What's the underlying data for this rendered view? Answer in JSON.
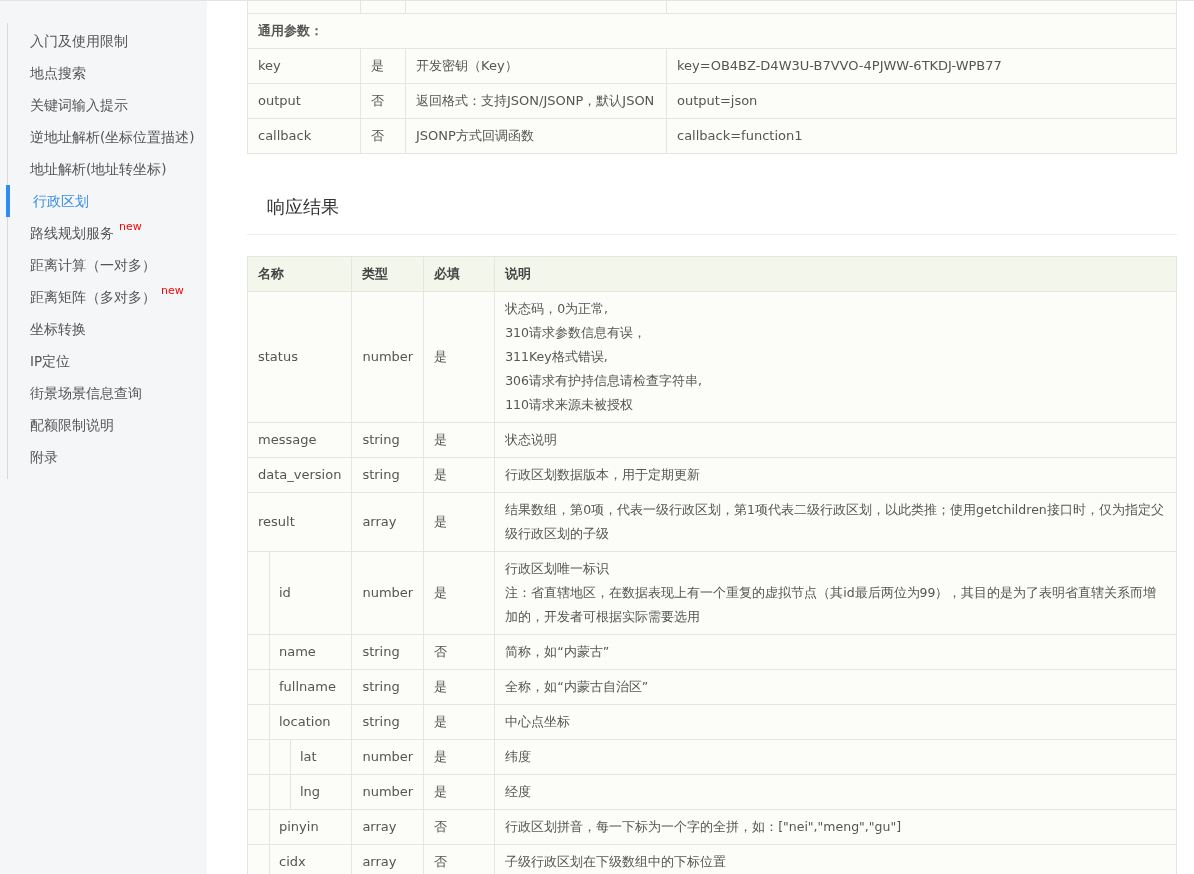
{
  "sidebar": {
    "items": [
      {
        "label": "入门及使用限制",
        "selected": false
      },
      {
        "label": "地点搜索",
        "selected": false
      },
      {
        "label": "关键词输入提示",
        "selected": false
      },
      {
        "label": "逆地址解析(坐标位置描述)",
        "selected": false
      },
      {
        "label": "地址解析(地址转坐标)",
        "selected": false
      },
      {
        "label": "行政区划",
        "selected": true
      },
      {
        "label": "路线规划服务",
        "selected": false,
        "badge": "new"
      },
      {
        "label": "距离计算（一对多）",
        "selected": false
      },
      {
        "label": "距离矩阵（多对多）",
        "selected": false,
        "badge": "new"
      },
      {
        "label": "坐标转换",
        "selected": false
      },
      {
        "label": "IP定位",
        "selected": false
      },
      {
        "label": "街景场景信息查询",
        "selected": false
      },
      {
        "label": "配额限制说明",
        "selected": false
      },
      {
        "label": "附录",
        "selected": false
      }
    ]
  },
  "params_table": {
    "section_title": "通用参数：",
    "rows": [
      {
        "name": "key",
        "required": "是",
        "desc": "开发密钥（Key）",
        "example": "key=OB4BZ-D4W3U-B7VVO-4PJWW-6TKDJ-WPB77"
      },
      {
        "name": "output",
        "required": "否",
        "desc": "返回格式：支持JSON/JSONP，默认JSON",
        "example": "output=json"
      },
      {
        "name": "callback",
        "required": "否",
        "desc": "JSONP方式回调函数",
        "example": "callback=function1"
      }
    ]
  },
  "response_heading": "响应结果",
  "response_table": {
    "columns": [
      "名称",
      "类型",
      "必填",
      "说明"
    ],
    "rows": [
      {
        "name": "status",
        "type": "number",
        "required": "是",
        "desc": [
          "状态码，0为正常,",
          "310请求参数信息有误，",
          "311Key格式错误,",
          "306请求有护持信息请检查字符串,",
          "110请求来源未被授权"
        ]
      },
      {
        "name": "message",
        "type": "string",
        "required": "是",
        "desc": [
          "状态说明"
        ]
      },
      {
        "name": "data_version",
        "type": "string",
        "required": "是",
        "desc": [
          "行政区划数据版本，用于定期更新"
        ]
      },
      {
        "name": "result",
        "type": "array",
        "required": "是",
        "desc": [
          "结果数组，第0项，代表一级行政区划，第1项代表二级行政区划，以此类推；使用getchildren接口时，仅为指定父级行政区划的子级"
        ],
        "children": [
          {
            "name": "id",
            "type": "number",
            "required": "是",
            "desc": [
              "行政区划唯一标识",
              "注：省直辖地区，在数据表现上有一个重复的虚拟节点（其id最后两位为99），其目的是为了表明省直辖关系而增加的，开发者可根据实际需要选用"
            ]
          },
          {
            "name": "name",
            "type": "string",
            "required": "否",
            "desc": [
              "简称，如“内蒙古”"
            ]
          },
          {
            "name": "fullname",
            "type": "string",
            "required": "是",
            "desc": [
              "全称，如“内蒙古自治区”"
            ]
          },
          {
            "name": "location",
            "type": "string",
            "required": "是",
            "desc": [
              "中心点坐标"
            ],
            "children": [
              {
                "name": "lat",
                "type": "number",
                "required": "是",
                "desc": [
                  "纬度"
                ]
              },
              {
                "name": "lng",
                "type": "number",
                "required": "是",
                "desc": [
                  "经度"
                ]
              }
            ]
          },
          {
            "name": "pinyin",
            "type": "array",
            "required": "否",
            "desc": [
              "行政区划拼音，每一下标为一个字的全拼，如：[\"nei\",\"meng\",\"gu\"]"
            ]
          },
          {
            "name": "cidx",
            "type": "array",
            "required": "否",
            "desc": [
              "子级行政区划在下级数组中的下标位置"
            ]
          }
        ]
      }
    ]
  }
}
